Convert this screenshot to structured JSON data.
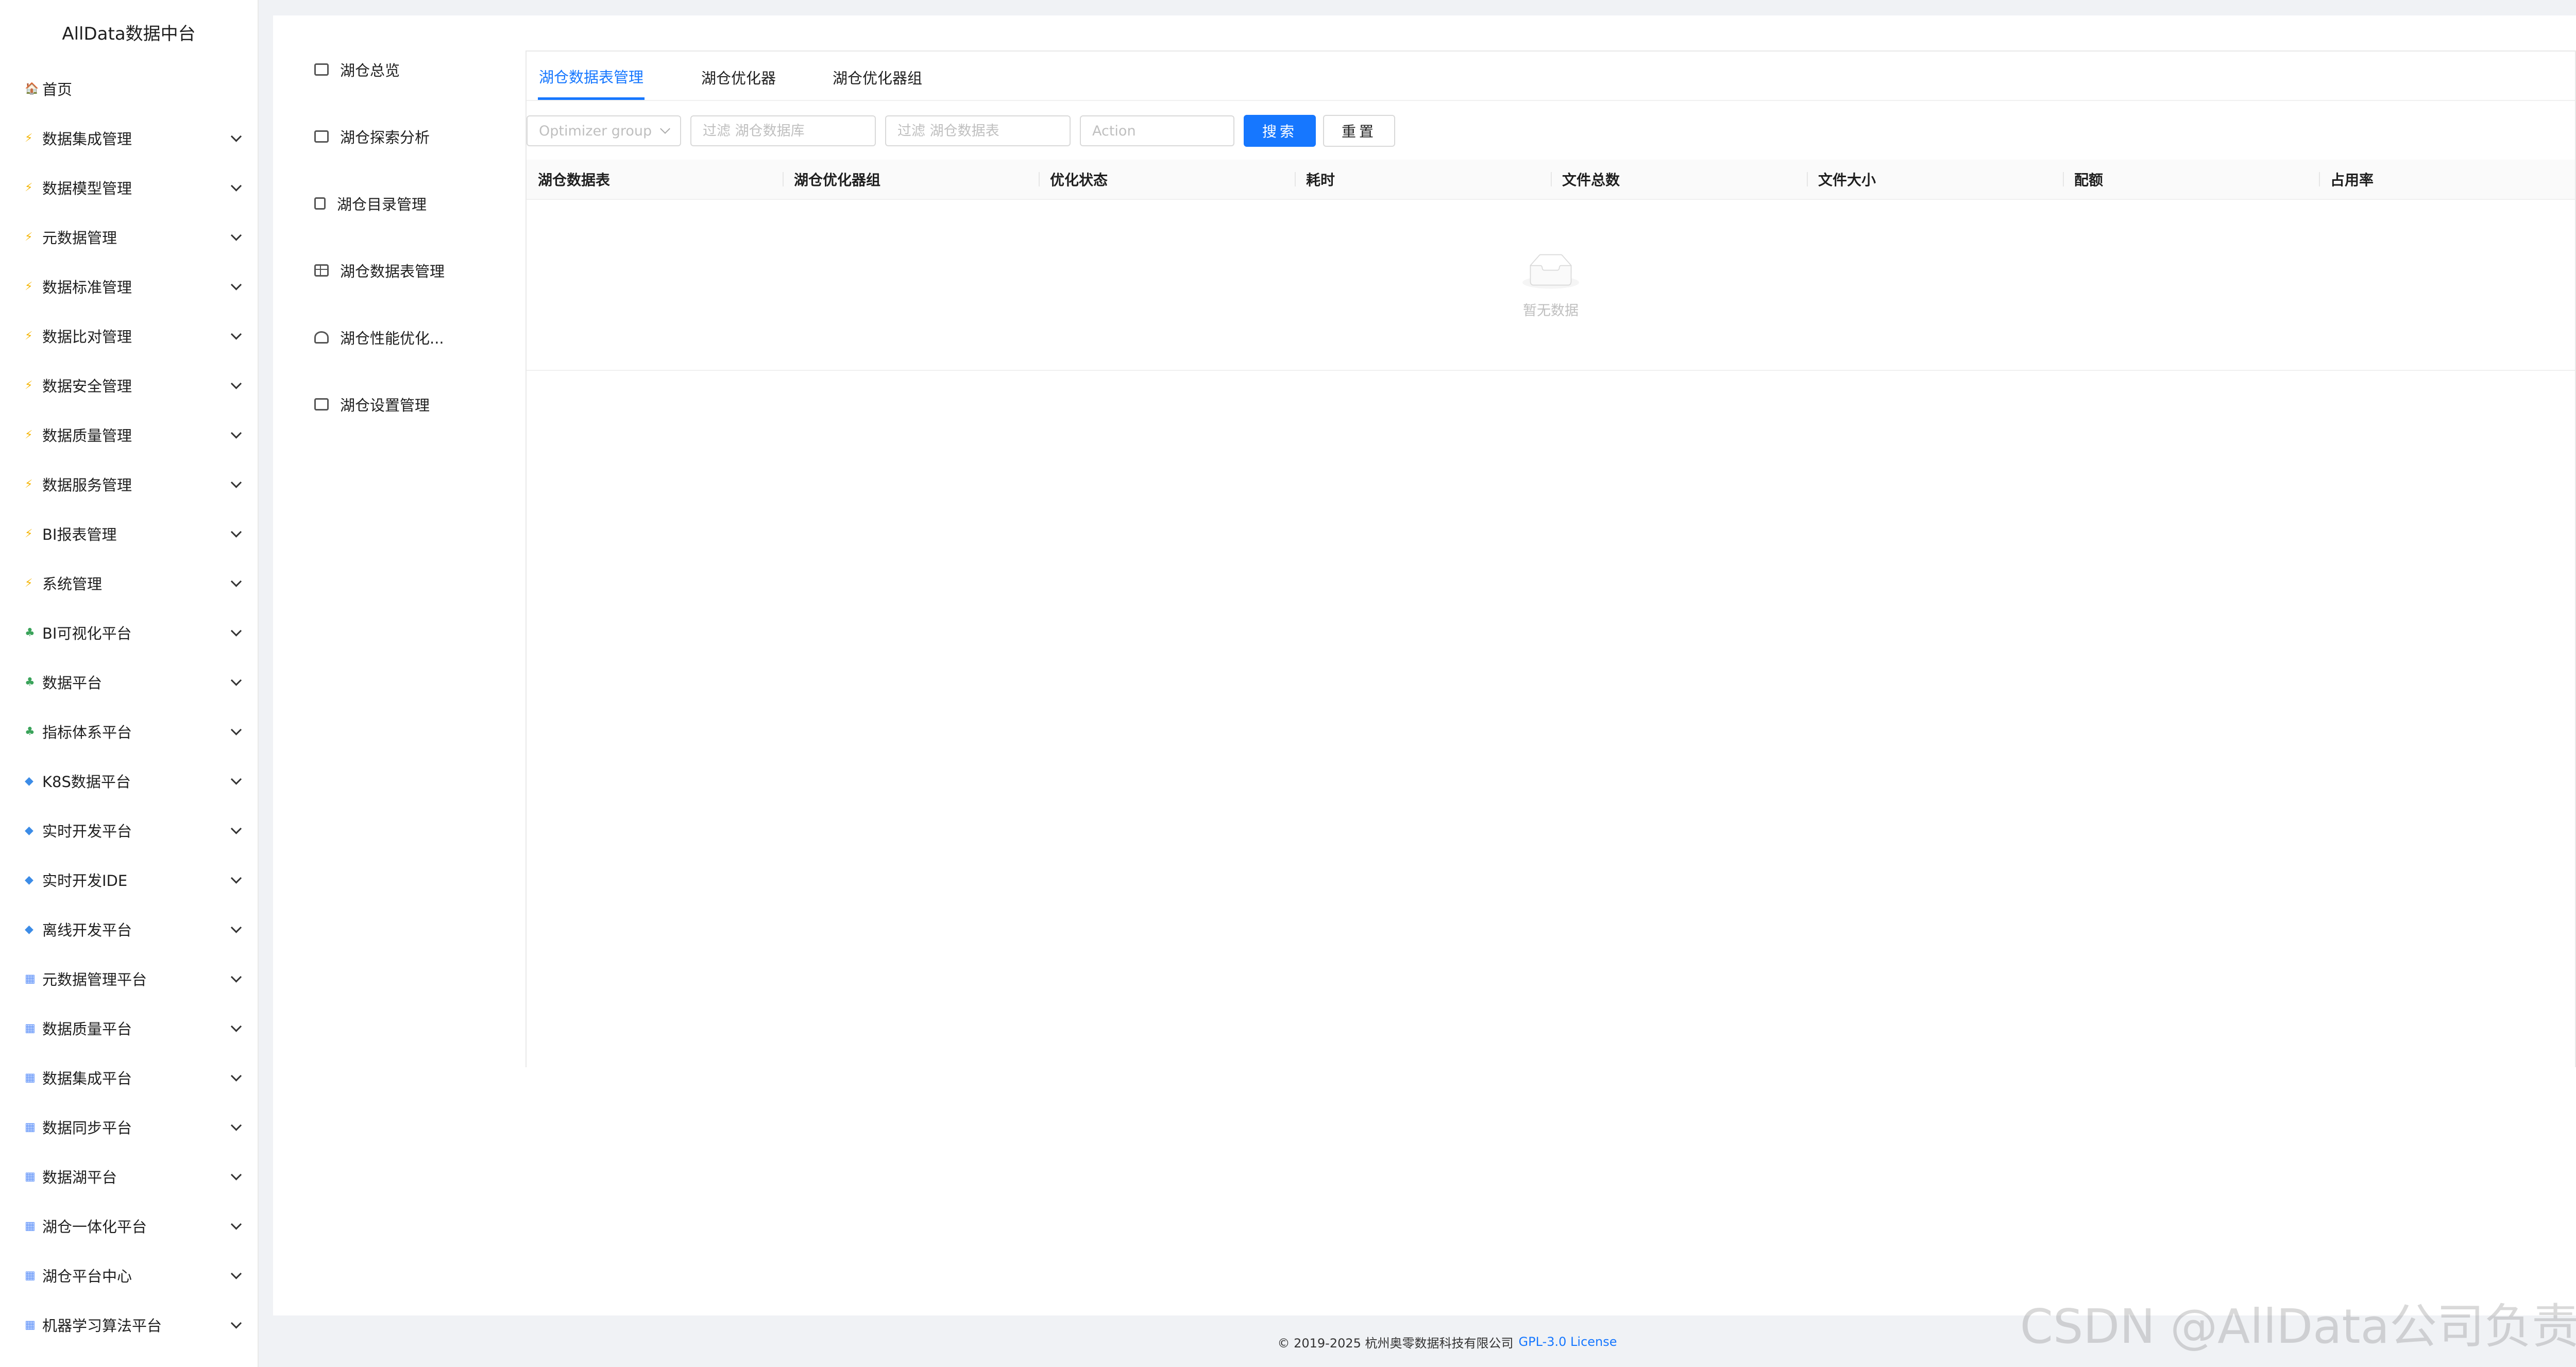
{
  "app": {
    "title": "AllData数据中台"
  },
  "sidebar": {
    "items": [
      {
        "label": "首页",
        "icon": "home-icon",
        "has_children": false
      },
      {
        "label": "数据集成管理",
        "icon": "lightning-icon",
        "has_children": true
      },
      {
        "label": "数据模型管理",
        "icon": "lightning-icon",
        "has_children": true
      },
      {
        "label": "元数据管理",
        "icon": "lightning-icon",
        "has_children": true
      },
      {
        "label": "数据标准管理",
        "icon": "lightning-icon",
        "has_children": true
      },
      {
        "label": "数据比对管理",
        "icon": "lightning-icon",
        "has_children": true
      },
      {
        "label": "数据安全管理",
        "icon": "lightning-icon",
        "has_children": true
      },
      {
        "label": "数据质量管理",
        "icon": "lightning-icon",
        "has_children": true
      },
      {
        "label": "数据服务管理",
        "icon": "lightning-icon",
        "has_children": true
      },
      {
        "label": "BI报表管理",
        "icon": "lightning-icon",
        "has_children": true
      },
      {
        "label": "系统管理",
        "icon": "lightning-icon",
        "has_children": true
      },
      {
        "label": "BI可视化平台",
        "icon": "tree-icon",
        "has_children": true
      },
      {
        "label": "数据平台",
        "icon": "tree-icon",
        "has_children": true
      },
      {
        "label": "指标体系平台",
        "icon": "tree-icon",
        "has_children": true
      },
      {
        "label": "K8S数据平台",
        "icon": "gem-icon",
        "has_children": true
      },
      {
        "label": "实时开发平台",
        "icon": "gem-icon",
        "has_children": true
      },
      {
        "label": "实时开发IDE",
        "icon": "gem-icon",
        "has_children": true
      },
      {
        "label": "离线开发平台",
        "icon": "gem-icon",
        "has_children": true
      },
      {
        "label": "元数据管理平台",
        "icon": "grid-icon",
        "has_children": true
      },
      {
        "label": "数据质量平台",
        "icon": "grid-icon",
        "has_children": true
      },
      {
        "label": "数据集成平台",
        "icon": "grid-icon",
        "has_children": true
      },
      {
        "label": "数据同步平台",
        "icon": "grid-icon",
        "has_children": true
      },
      {
        "label": "数据湖平台",
        "icon": "grid-icon",
        "has_children": true
      },
      {
        "label": "湖仓一体化平台",
        "icon": "grid-icon",
        "has_children": true
      },
      {
        "label": "湖仓平台中心",
        "icon": "grid-icon",
        "has_children": true
      },
      {
        "label": "机器学习算法平台",
        "icon": "grid-icon",
        "has_children": true
      }
    ]
  },
  "subnav": {
    "items": [
      {
        "label": "湖仓总览",
        "icon": "dashboard-icon"
      },
      {
        "label": "湖仓探索分析",
        "icon": "terminal-icon"
      },
      {
        "label": "湖仓目录管理",
        "icon": "document-icon"
      },
      {
        "label": "湖仓数据表管理",
        "icon": "table-icon"
      },
      {
        "label": "湖仓性能优化...",
        "icon": "gauge-icon"
      },
      {
        "label": "湖仓设置管理",
        "icon": "monitor-icon"
      }
    ]
  },
  "tabs": [
    {
      "label": "湖仓数据表管理",
      "active": true
    },
    {
      "label": "湖仓优化器",
      "active": false
    },
    {
      "label": "湖仓优化器组",
      "active": false
    }
  ],
  "filters": {
    "optimizer_group_placeholder": "Optimizer group",
    "database_placeholder": "过滤 湖仓数据库",
    "table_placeholder": "过滤 湖仓数据表",
    "action_placeholder": "Action",
    "search_label": "搜索",
    "reset_label": "重置"
  },
  "table": {
    "columns": [
      "湖仓数据表",
      "湖仓优化器组",
      "优化状态",
      "耗时",
      "文件总数",
      "文件大小",
      "配额",
      "占用率"
    ],
    "empty_text": "暂无数据"
  },
  "footer": {
    "copyright": "© 2019-2025 杭州奥零数据科技有限公司",
    "license_link": "GPL-3.0 License"
  },
  "watermark": "CSDN @AllData公司负责人",
  "colors": {
    "accent": "#1677ff",
    "background": "#f0f2f5"
  }
}
